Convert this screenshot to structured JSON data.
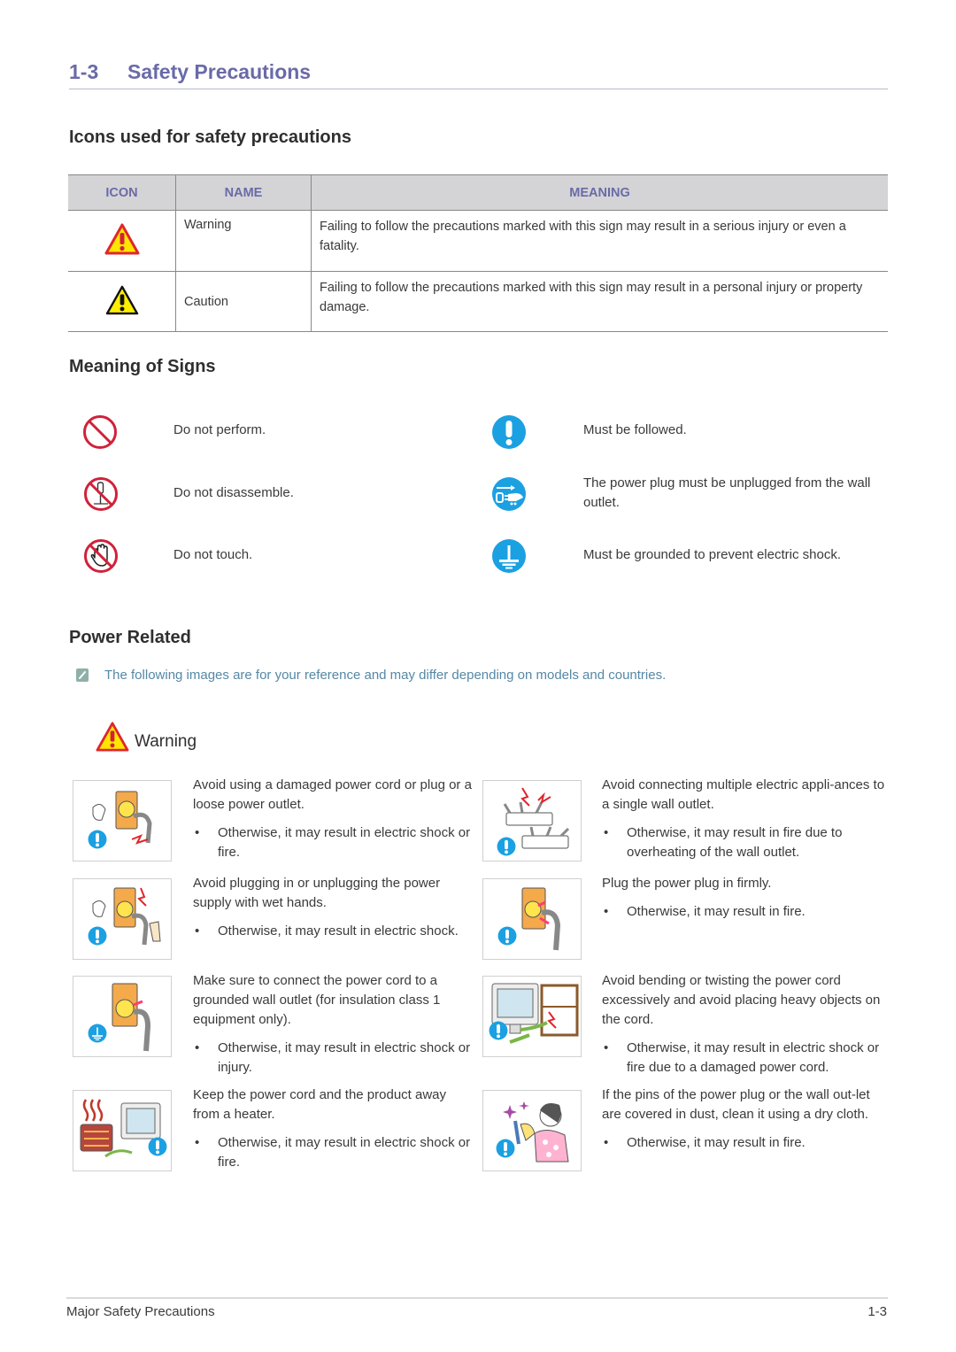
{
  "section": {
    "number": "1-3",
    "title": "Safety Precautions"
  },
  "icons_section": {
    "heading": "Icons used for safety precautions",
    "table": {
      "headers": [
        "ICON",
        "NAME",
        "MEANING"
      ],
      "rows": [
        {
          "icon": "warning-triangle-red-icon",
          "name": "Warning",
          "meaning": "Failing to follow the precautions marked with this sign may result in a serious injury or even a fatality."
        },
        {
          "icon": "caution-triangle-black-icon",
          "name": "Caution",
          "meaning": "Failing to follow the precautions marked with this sign may result in a personal injury or property damage."
        }
      ]
    }
  },
  "signs_section": {
    "heading": "Meaning of Signs",
    "left": [
      {
        "icon": "prohibited-icon",
        "text": "Do not perform."
      },
      {
        "icon": "do-not-disassemble-icon",
        "text": "Do not disassemble."
      },
      {
        "icon": "do-not-touch-icon",
        "text": "Do not touch."
      }
    ],
    "right": [
      {
        "icon": "must-follow-icon",
        "text": "Must be followed."
      },
      {
        "icon": "unplug-icon",
        "text": "The power plug must be unplugged from the wall outlet."
      },
      {
        "icon": "ground-icon",
        "text": "Must be grounded to prevent electric shock."
      }
    ]
  },
  "power_section": {
    "heading": "Power Related",
    "note": "The following images are for your reference and may differ depending on models and countries.",
    "warning_label": "Warning",
    "items": [
      {
        "illustration": "damaged-plug-illustration",
        "badge": "must-follow",
        "text": "Avoid using a damaged power cord or plug or a loose power outlet.",
        "bullet": "Otherwise, it may result in electric shock or fire."
      },
      {
        "illustration": "multiple-appliances-illustration",
        "badge": "must-follow",
        "text": "Avoid connecting multiple electric appli-ances to a single wall outlet.",
        "bullet": "Otherwise, it may result in fire due to overheating of the wall outlet."
      },
      {
        "illustration": "wet-hands-illustration",
        "badge": "must-follow",
        "text": "Avoid plugging in or unplugging the power supply with wet hands.",
        "bullet": "Otherwise, it may result in electric shock."
      },
      {
        "illustration": "plug-firmly-illustration",
        "badge": "must-follow",
        "text": "Plug the power plug in firmly.",
        "bullet": "Otherwise, it may result in fire."
      },
      {
        "illustration": "grounded-outlet-illustration",
        "badge": "ground",
        "text": "Make sure to connect the power cord to a grounded wall outlet (for insulation class 1 equipment only).",
        "bullet": "Otherwise, it may result in electric shock or injury."
      },
      {
        "illustration": "bent-cord-illustration",
        "badge": "must-follow",
        "text": "Avoid bending or twisting the power cord excessively and avoid placing heavy objects on the cord.",
        "bullet": "Otherwise, it may result in electric shock or fire due to a damaged power cord."
      },
      {
        "illustration": "heater-illustration",
        "badge": "must-follow",
        "text": "Keep the power cord and the product away from a heater.",
        "bullet": "Otherwise, it may result in electric shock or fire."
      },
      {
        "illustration": "dusty-plug-illustration",
        "badge": "must-follow",
        "text": "If the pins of the power plug or the wall out-let are covered in dust, clean it using a dry cloth.",
        "bullet": "Otherwise, it may result in fire."
      }
    ]
  },
  "footer": {
    "left": "Major Safety Precautions",
    "right": "1-3"
  },
  "colors": {
    "title": "#6a6aa8",
    "table_header_bg": "#d4d4d6",
    "prohibit_red": "#d0213a",
    "info_blue": "#1ba0e2",
    "note_text": "#5588a6",
    "warning_yellow": "#ffe600",
    "warning_red": "#e0262c"
  },
  "bullet_char": "•"
}
